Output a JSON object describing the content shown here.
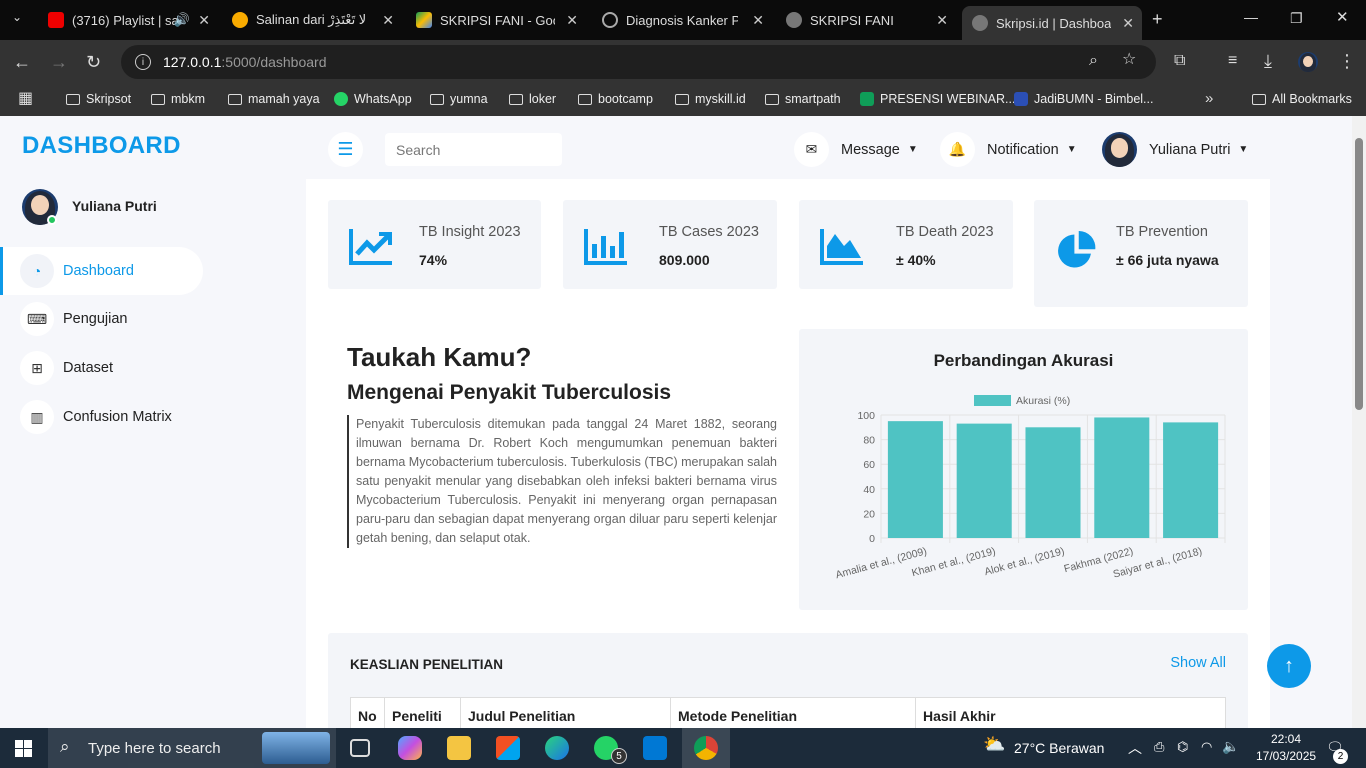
{
  "browser": {
    "tabs": [
      {
        "title": "(3716) Playlist | sa",
        "icon": "youtube-icon"
      },
      {
        "title": "Salinan dari لا تَعْتَذِرْ",
        "icon": "colab-icon"
      },
      {
        "title": "SKRIPSI FANI - Googl",
        "icon": "google-drive-icon"
      },
      {
        "title": "Diagnosis Kanker Pay",
        "icon": "chatgpt-icon"
      },
      {
        "title": "SKRIPSI FANI",
        "icon": "globe-icon"
      },
      {
        "title": "Skripsi.id | Dashboard",
        "icon": "globe-icon"
      }
    ],
    "url_host": "127.0.0.1",
    "url_path": ":5000/dashboard",
    "bookmarks": [
      "Skripsot",
      "mbkm",
      "mamah yaya",
      "WhatsApp",
      "yumna",
      "loker",
      "bootcamp",
      "myskill.id",
      "smartpath",
      "PRESENSI WEBINAR...",
      "JadiBUMN - Bimbel..."
    ],
    "all_bookmarks": "All Bookmarks"
  },
  "sidebar": {
    "brand": "DASHBOARD",
    "user": "Yuliana Putri",
    "items": [
      {
        "label": "Dashboard",
        "icon": "gauge-icon",
        "active": true
      },
      {
        "label": "Pengujian",
        "icon": "keyboard-icon",
        "active": false
      },
      {
        "label": "Dataset",
        "icon": "table-icon",
        "active": false
      },
      {
        "label": "Confusion Matrix",
        "icon": "bar-chart-icon",
        "active": false
      }
    ]
  },
  "topbar": {
    "search_placeholder": "Search",
    "message": "Message",
    "notification": "Notification",
    "user": "Yuliana Putri"
  },
  "cards": [
    {
      "title": "TB Insight 2023",
      "value": "74%",
      "icon": "trend-up-icon"
    },
    {
      "title": "TB Cases 2023",
      "value": "809.000",
      "icon": "bars-icon"
    },
    {
      "title": "TB Death 2023",
      "value": "± 40%",
      "icon": "area-chart-icon"
    },
    {
      "title": "TB Prevention",
      "value": "± 66 juta nyawa",
      "icon": "pie-chart-icon"
    }
  ],
  "info": {
    "heading": "Taukah Kamu?",
    "subheading": "Mengenai Penyakit Tuberculosis",
    "paragraph": "Penyakit Tuberculosis ditemukan pada tanggal 24 Maret 1882, seorang ilmuwan bernama Dr. Robert Koch mengumumkan penemuan bakteri bernama Mycobacterium tuberculosis. Tuberkulosis (TBC) merupakan salah satu penyakit menular yang disebabkan oleh infeksi bakteri bernama virus Mycobacterium Tuberculosis. Penyakit ini menyerang organ pernapasan paru-paru dan sebagian dapat menyerang organ diluar paru seperti kelenjar getah bening, dan selaput otak."
  },
  "chart_data": {
    "type": "bar",
    "title": "Perbandingan Akurasi",
    "categories": [
      "Amalia et al., (2009)",
      "Khan et al., (2019)",
      "Alok et al., (2019)",
      "Fakhma (2022)",
      "Saiyar et al., (2018)"
    ],
    "series": [
      {
        "name": "Akurasi (%)",
        "values": [
          95,
          93,
          90,
          98,
          94
        ]
      }
    ],
    "ylim": [
      0,
      100
    ],
    "yticks": [
      0,
      20,
      40,
      60,
      80,
      100
    ],
    "legend": "top",
    "color": "#4fc3c3",
    "grid": true
  },
  "table": {
    "title": "KEASLIAN PENELITIAN",
    "show_all": "Show All",
    "headers": [
      "No",
      "Peneliti",
      "Judul Penelitian",
      "Metode Penelitian",
      "Hasil Akhir"
    ]
  },
  "taskbar": {
    "search_placeholder": "Type here to search",
    "weather": "27°C  Berawan",
    "time": "22:04",
    "date": "17/03/2025",
    "notif_count": "2",
    "whatsapp_badge": "5"
  },
  "colors": {
    "accent": "#0d99e8",
    "bar": "#4fc3c3"
  }
}
